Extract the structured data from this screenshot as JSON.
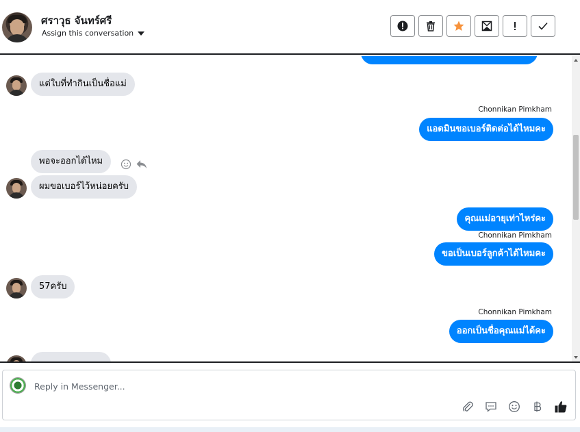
{
  "header": {
    "contact_name": "ศราวุธ จันทร์ศรี",
    "assign_label": "Assign this conversation",
    "toolbar": [
      {
        "name": "spam-button",
        "icon": "alert-circle-icon"
      },
      {
        "name": "delete-button",
        "icon": "trash-icon"
      },
      {
        "name": "star-button",
        "icon": "star-icon",
        "color": "#f7923b"
      },
      {
        "name": "mark-unread-button",
        "icon": "envelope-icon"
      },
      {
        "name": "important-button",
        "icon": "exclamation-icon"
      },
      {
        "name": "done-button",
        "icon": "check-icon"
      }
    ]
  },
  "messages": [
    {
      "side": "in",
      "text": "แต่ใบที่ทำกินเป็นชื่อแม่"
    },
    {
      "side": "out",
      "sender": "Chonnikan Pimkham",
      "text": "แอดมินขอเบอร์ติดต่อได้ไหมคะ"
    },
    {
      "side": "in",
      "text": "พอจะออกได้ไหม"
    },
    {
      "side": "in",
      "text": "ผมขอเบอร์ไว้หน่อยครับ"
    },
    {
      "side": "out",
      "text": "คุณแม่อายุเท่าไหร่คะ"
    },
    {
      "side": "out",
      "sender": "Chonnikan Pimkham",
      "text": "ขอเป็นเบอร์ลูกค้าได้ไหมคะ"
    },
    {
      "side": "in",
      "text": "57ครับ"
    },
    {
      "side": "out",
      "sender": "Chonnikan Pimkham",
      "text": "ออกเป็นชื่อคุณแม่ได้คะ"
    }
  ],
  "reply": {
    "placeholder": "Reply in Messenger...",
    "tools": [
      "attachment-icon",
      "saved-reply-icon",
      "emoji-icon",
      "baht-icon",
      "thumbs-up-icon"
    ]
  },
  "colors": {
    "outgoing_bubble": "#0084ff",
    "incoming_bubble": "#e4e6eb",
    "star": "#f7923b"
  }
}
